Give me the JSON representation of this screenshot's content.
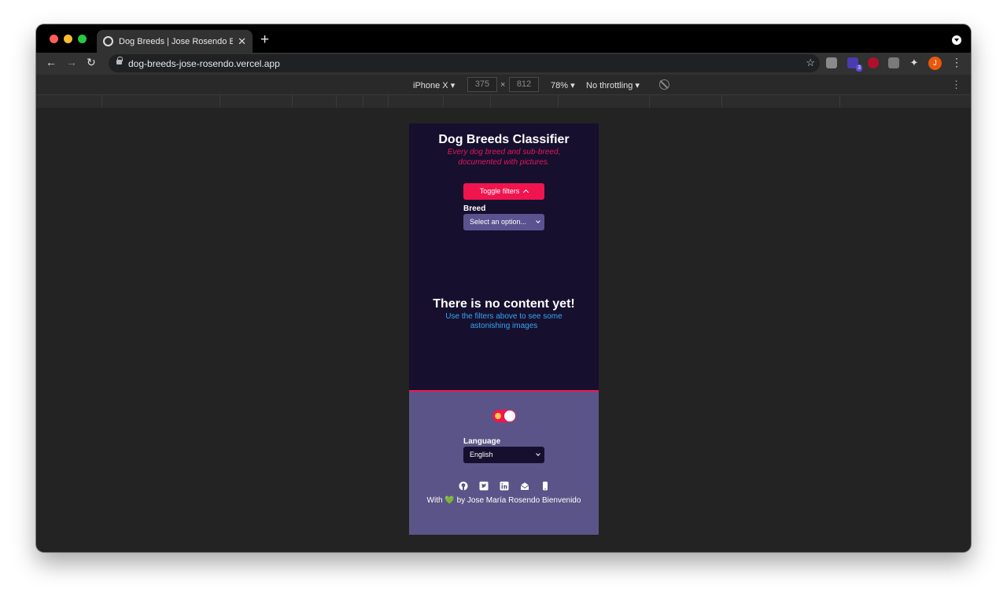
{
  "browser": {
    "tab_title": "Dog Breeds | Jose Rosendo Bienvenido",
    "tab_close": "✕",
    "new_tab": "+",
    "url": "dog-breeds-jose-rosendo.vercel.app",
    "extension_badge": "3",
    "profile_initial": "J"
  },
  "devtools": {
    "device": "iPhone X ▾",
    "width": "375",
    "times": "×",
    "height": "812",
    "zoom": "78% ▾",
    "throttling": "No throttling ▾"
  },
  "app": {
    "title": "Dog Breeds Classifier",
    "subtitle": "Every dog breed and sub-breed, documented with pictures.",
    "toggle_filters": "Toggle filters",
    "breed_label": "Breed",
    "breed_placeholder": "Select an option...",
    "empty_title": "There is no content yet!",
    "empty_text": "Use the filters above to see some astonishing images",
    "language_label": "Language",
    "language_value": "English",
    "credit_prefix": "With",
    "credit_heart": "💚",
    "credit_suffix": "by Jose María Rosendo Bienvenido"
  },
  "icons": [
    "github-icon",
    "twitter-icon",
    "linkedin-icon",
    "mail-icon",
    "phone-icon"
  ],
  "colors": {
    "accent": "#f0154f",
    "app_bg": "#160f2e",
    "footer_bg": "#5b5488",
    "link_blue": "#35a8f0"
  }
}
